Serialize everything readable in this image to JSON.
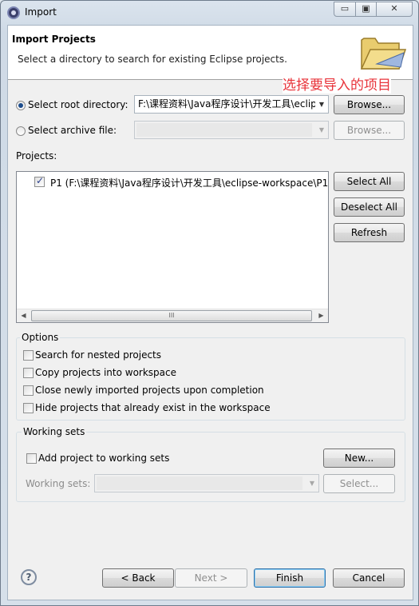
{
  "window": {
    "title": "Import",
    "min_icon": "minimize-icon",
    "max_icon": "maximize-icon",
    "close_icon": "close-icon"
  },
  "banner": {
    "title": "Import Projects",
    "description": "Select a directory to search for existing Eclipse projects.",
    "icon": "folder-icon",
    "annotation": "选择要导入的项目",
    "annotation_color": "#e8333a"
  },
  "source": {
    "root_label": "Select root directory:",
    "root_selected": true,
    "root_value": "F:\\课程资料\\Java程序设计\\开发工具\\eclip",
    "root_browse": "Browse...",
    "archive_label": "Select archive file:",
    "archive_selected": false,
    "archive_value": "",
    "archive_browse": "Browse..."
  },
  "projects": {
    "label": "Projects:",
    "items": [
      {
        "label": "P1 (F:\\课程资料\\Java程序设计\\开发工具\\eclipse-workspace\\P1",
        "checked": true
      }
    ],
    "select_all": "Select All",
    "deselect_all": "Deselect All",
    "refresh": "Refresh",
    "scroll_thumb": "III"
  },
  "options": {
    "title": "Options",
    "items": [
      {
        "label": "Search for nested projects",
        "checked": false
      },
      {
        "label": "Copy projects into workspace",
        "checked": false
      },
      {
        "label": "Close newly imported projects upon completion",
        "checked": false
      },
      {
        "label": "Hide projects that already exist in the workspace",
        "checked": false
      }
    ]
  },
  "working_sets": {
    "title": "Working sets",
    "add_label": "Add project to working sets",
    "add_checked": false,
    "new_button": "New...",
    "sets_label": "Working sets:",
    "sets_value": "",
    "select_button": "Select..."
  },
  "footer": {
    "help_icon": "help-icon",
    "back": "< Back",
    "next": "Next >",
    "finish": "Finish",
    "cancel": "Cancel"
  }
}
